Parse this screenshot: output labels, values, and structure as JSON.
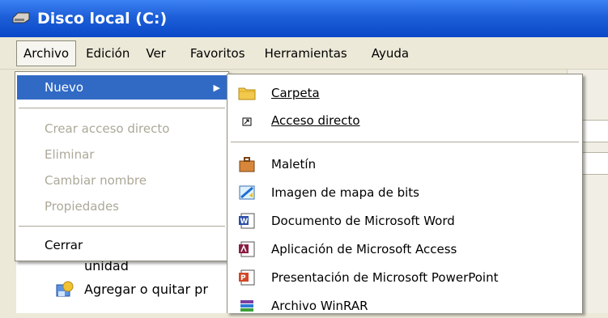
{
  "window": {
    "title": "Disco local  (C:)"
  },
  "menubar": [
    "Archivo",
    "Edición",
    "Ver",
    "Favoritos",
    "Herramientas",
    "Ayuda"
  ],
  "archivo_menu": {
    "items": [
      {
        "label": "Nuevo",
        "state": "highlighted",
        "submenu": true
      },
      {
        "label": "Crear acceso directo",
        "state": "disabled"
      },
      {
        "label": "Eliminar",
        "state": "disabled"
      },
      {
        "label": "Cambiar nombre",
        "state": "disabled"
      },
      {
        "label": "Propiedades",
        "state": "disabled"
      },
      {
        "label": "Cerrar",
        "state": "normal"
      }
    ]
  },
  "nuevo_submenu": {
    "items": [
      {
        "label": "Carpeta",
        "icon": "folder-icon"
      },
      {
        "label": "Acceso directo",
        "icon": "shortcut-icon"
      },
      {
        "label": "Maletín",
        "icon": "briefcase-icon"
      },
      {
        "label": "Imagen de mapa de bits",
        "icon": "bitmap-icon"
      },
      {
        "label": "Documento de Microsoft Word",
        "icon": "word-icon"
      },
      {
        "label": "Aplicación de Microsoft Access",
        "icon": "access-icon"
      },
      {
        "label": "Presentación de Microsoft PowerPoint",
        "icon": "powerpoint-icon"
      },
      {
        "label": "Archivo WinRAR",
        "icon": "winrar-icon"
      }
    ]
  },
  "background": {
    "task1": "unidad",
    "task2": "Agregar o quitar pr"
  },
  "colors": {
    "title_bar": "#0a48c8",
    "highlight": "#316ac5",
    "disabled": "#aca899"
  }
}
